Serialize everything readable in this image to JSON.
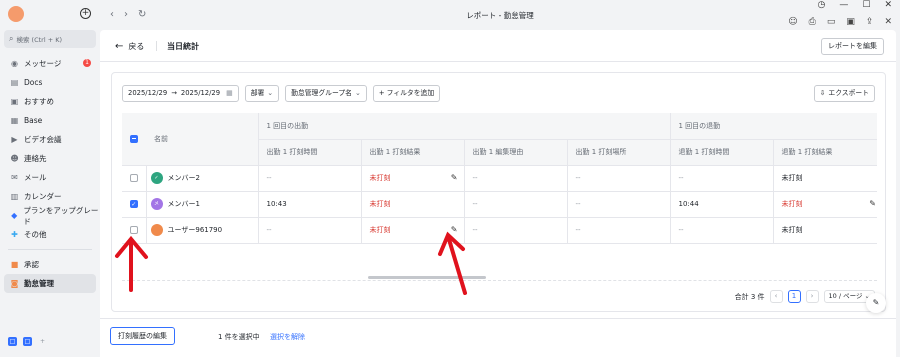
{
  "sidebar": {
    "search_placeholder": "検索 (Ctrl + K)",
    "items": [
      {
        "label": "メッセージ",
        "icon": "chat-icon",
        "badge": "1"
      },
      {
        "label": "Docs",
        "icon": "docs-icon"
      },
      {
        "label": "おすすめ",
        "icon": "star-icon"
      },
      {
        "label": "Base",
        "icon": "base-icon"
      },
      {
        "label": "ビデオ会議",
        "icon": "video-icon"
      },
      {
        "label": "連絡先",
        "icon": "contacts-icon"
      },
      {
        "label": "メール",
        "icon": "mail-icon"
      },
      {
        "label": "カレンダー",
        "icon": "calendar-icon"
      },
      {
        "label": "プランをアップグレード",
        "icon": "diamond-icon"
      },
      {
        "label": "その他",
        "icon": "more-icon"
      }
    ],
    "apps": [
      {
        "label": "承認",
        "icon": "approval-icon"
      },
      {
        "label": "勤怠管理",
        "icon": "attendance-icon"
      }
    ]
  },
  "titlebar": {
    "title": "レポート - 勤怠管理"
  },
  "header": {
    "back_label": "戻る",
    "page_title": "当日統計",
    "edit_report_label": "レポートを編集"
  },
  "filters": {
    "date_start": "2025/12/29",
    "date_separator": "→",
    "date_end": "2025/12/29",
    "department": "部署",
    "group": "勤怠管理グループ名",
    "add_filter": "+ フィルタを追加",
    "export": "エクスポート"
  },
  "table": {
    "name_header": "名前",
    "group_headers": [
      "1 回目の出勤",
      "1 回目の退勤"
    ],
    "sub_headers": [
      "出勤 1 打刻時間",
      "出勤 1 打刻結果",
      "出勤 1 編集理由",
      "出勤 1 打刻場所",
      "退勤 1 打刻時間",
      "退勤 1 打刻結果"
    ],
    "rows": [
      {
        "name": "メンバー2",
        "avatar_color": "#2ea580",
        "avatar_text": "",
        "checked": false,
        "cells": [
          "--",
          "未打刻",
          "--",
          "--",
          "--",
          "未打刻"
        ]
      },
      {
        "name": "メンバー1",
        "avatar_color": "#a375e6",
        "avatar_text": "メ",
        "checked": true,
        "cells": [
          "10:43",
          "未打刻",
          "--",
          "--",
          "10:44",
          "未打刻"
        ]
      },
      {
        "name": "ユーザー961790",
        "avatar_color": "#f08a4b",
        "avatar_text": "",
        "checked": false,
        "cells": [
          "--",
          "未打刻",
          "--",
          "--",
          "--",
          "未打刻"
        ]
      }
    ]
  },
  "pagination": {
    "total": "合計 3 件",
    "current_page": "1",
    "page_size": "10 / ページ"
  },
  "footer": {
    "edit_history": "打刻履歴の編集",
    "selected": "1 件を選択中",
    "clear_selection": "選択を解除"
  },
  "colors": {
    "accent": "#3370ff",
    "danger": "#d83931",
    "annotation": "#e0121d"
  }
}
